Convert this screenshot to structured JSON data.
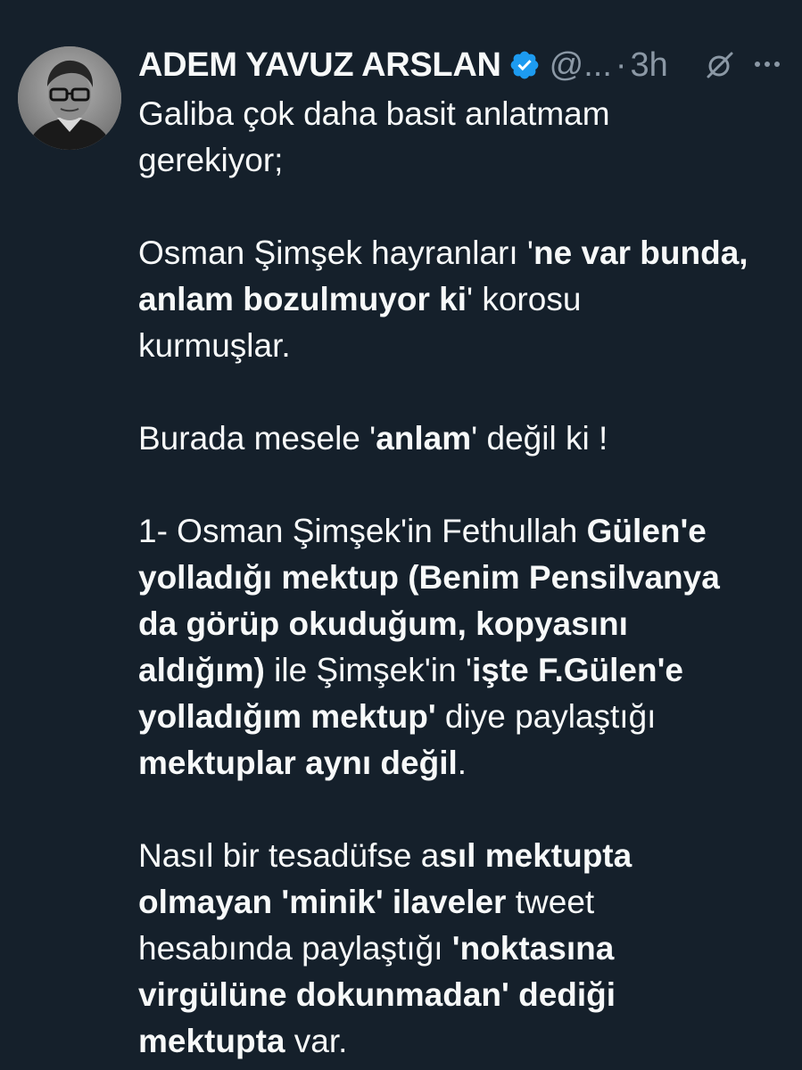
{
  "author": {
    "display_name": "ADEM YAVUZ ARSLAN",
    "handle": "@...",
    "separator": "·",
    "time": "3h",
    "verified": true
  },
  "colors": {
    "background": "#15202b",
    "text": "#f7f9f9",
    "muted": "#8b98a5",
    "verified_badge": "#1d9bf0"
  },
  "icons": {
    "avatar": "author-avatar",
    "verified": "verified-badge-icon",
    "grok": "grok-icon",
    "more": "more-options-icon"
  },
  "body": {
    "paragraphs": [
      {
        "lines": [
          [
            {
              "text": "Galiba çok daha basit anlatmam",
              "bold": false
            }
          ],
          [
            {
              "text": "gerekiyor;",
              "bold": false
            }
          ]
        ]
      },
      {
        "lines": [
          [
            {
              "text": "Osman Şimşek hayranları '",
              "bold": false
            },
            {
              "text": "ne var bunda,",
              "bold": true
            }
          ],
          [
            {
              "text": "anlam bozulmuyor ki",
              "bold": true
            },
            {
              "text": "' korosu",
              "bold": false
            }
          ],
          [
            {
              "text": "kurmuşlar.",
              "bold": false
            }
          ]
        ]
      },
      {
        "lines": [
          [
            {
              "text": "Burada mesele '",
              "bold": false
            },
            {
              "text": "anlam",
              "bold": true
            },
            {
              "text": "' değil ki !",
              "bold": false
            }
          ]
        ]
      },
      {
        "lines": [
          [
            {
              "text": "1- Osman Şimşek'in Fethullah ",
              "bold": false
            },
            {
              "text": "Gülen'e",
              "bold": true
            }
          ],
          [
            {
              "text": "yolladığı mektup (Benim Pensilvanya",
              "bold": true
            }
          ],
          [
            {
              "text": "da görüp okuduğum, kopyasını",
              "bold": true
            }
          ],
          [
            {
              "text": "aldığım)",
              "bold": true
            },
            {
              "text": " ile Şimşek'in '",
              "bold": false
            },
            {
              "text": "işte F.Gülen'e",
              "bold": true
            }
          ],
          [
            {
              "text": "yolladığım mektup'",
              "bold": true
            },
            {
              "text": " diye paylaştığı",
              "bold": false
            }
          ],
          [
            {
              "text": "mektuplar aynı değil",
              "bold": true
            },
            {
              "text": ".",
              "bold": false
            }
          ]
        ]
      },
      {
        "lines": [
          [
            {
              "text": "Nasıl bir tesadüfse a",
              "bold": false
            },
            {
              "text": "sıl mektupta",
              "bold": true
            }
          ],
          [
            {
              "text": "olmayan 'minik' ilaveler",
              "bold": true
            },
            {
              "text": " tweet",
              "bold": false
            }
          ],
          [
            {
              "text": "hesabında paylaştığı ",
              "bold": false
            },
            {
              "text": "'noktasına",
              "bold": true
            }
          ],
          [
            {
              "text": "virgülüne dokunmadan' dediği",
              "bold": true
            }
          ],
          [
            {
              "text": "mektupta",
              "bold": true
            },
            {
              "text": " var.",
              "bold": false
            }
          ]
        ]
      }
    ]
  }
}
